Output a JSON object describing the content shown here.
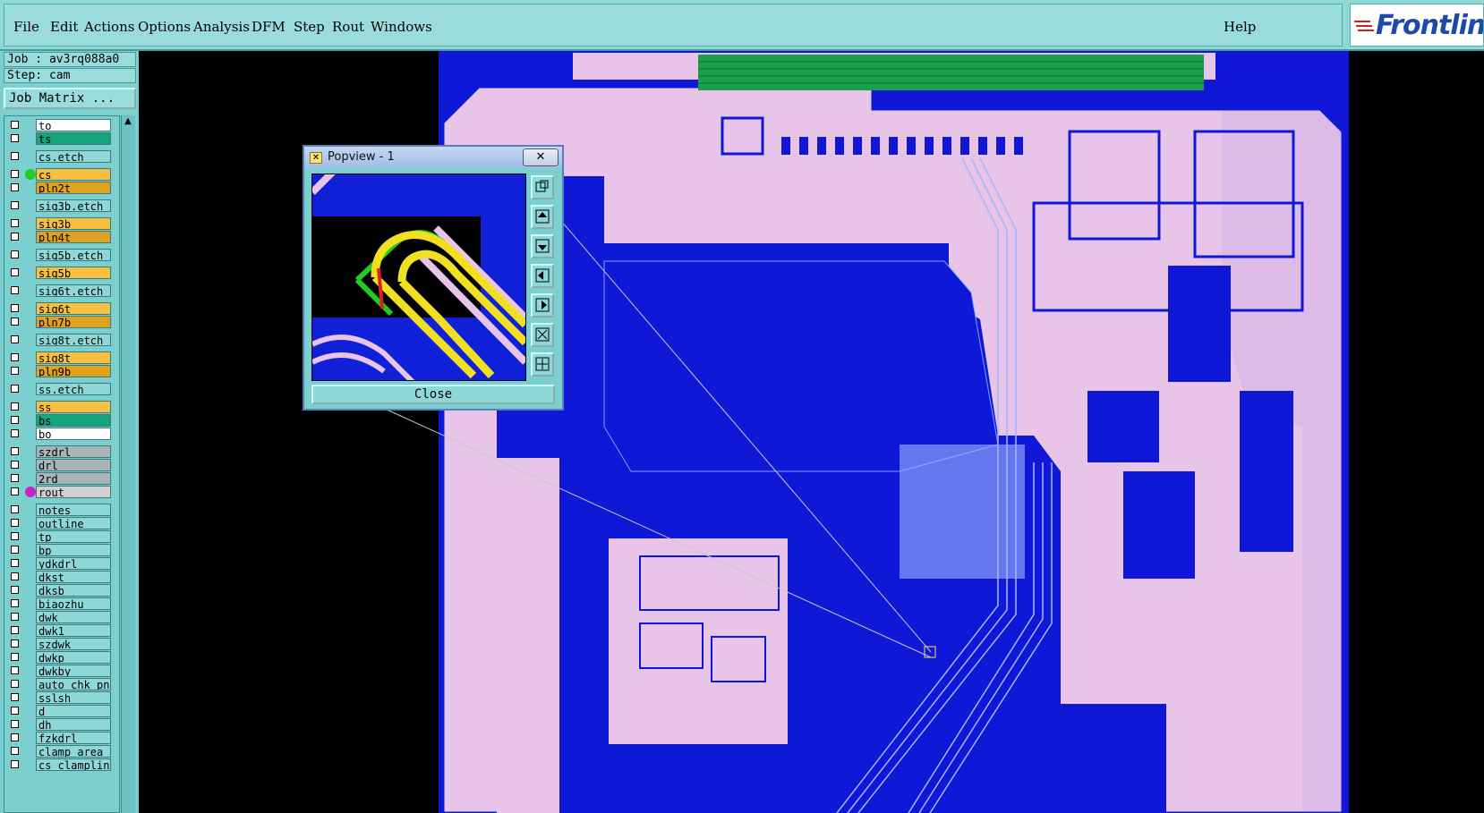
{
  "menu": {
    "items": [
      {
        "label": "File",
        "key": "file"
      },
      {
        "label": "Edit",
        "key": "edit"
      },
      {
        "label": "Actions",
        "key": "actions"
      },
      {
        "label": "Options",
        "key": "options"
      },
      {
        "label": "Analysis",
        "key": "analysis"
      },
      {
        "label": "DFM",
        "key": "dfm"
      },
      {
        "label": "Step",
        "key": "step"
      },
      {
        "label": "Rout",
        "key": "rout"
      },
      {
        "label": "Windows",
        "key": "windows"
      }
    ],
    "help": "Help"
  },
  "logo": {
    "text": "Frontline",
    "brand_color": "#1c4aa8"
  },
  "job": {
    "job_line": "Job : av3rq088a0",
    "step_line": "Step: cam",
    "matrix_button": "Job Matrix ..."
  },
  "layers": [
    {
      "name": "to",
      "color": "#ffffff",
      "dot": ""
    },
    {
      "name": "ts",
      "color": "#14a67a",
      "dot": ""
    },
    {
      "name": "cs.etch",
      "color": "#8fd8d8",
      "dot": ""
    },
    {
      "name": "cs",
      "color": "#f8c040",
      "dot": "#22cc22"
    },
    {
      "name": "pln2t",
      "color": "#e0a020",
      "dot": ""
    },
    {
      "name": "sig3b.etch",
      "color": "#8fd8d8",
      "dot": ""
    },
    {
      "name": "sig3b",
      "color": "#f8c040",
      "dot": ""
    },
    {
      "name": "pln4t",
      "color": "#e0a020",
      "dot": ""
    },
    {
      "name": "sig5b.etch",
      "color": "#8fd8d8",
      "dot": ""
    },
    {
      "name": "sig5b",
      "color": "#f8c040",
      "dot": ""
    },
    {
      "name": "sig6t.etch",
      "color": "#8fd8d8",
      "dot": ""
    },
    {
      "name": "sig6t",
      "color": "#f8c040",
      "dot": ""
    },
    {
      "name": "pln7b",
      "color": "#e0a020",
      "dot": ""
    },
    {
      "name": "sig8t.etch",
      "color": "#8fd8d8",
      "dot": ""
    },
    {
      "name": "sig8t",
      "color": "#f8c040",
      "dot": ""
    },
    {
      "name": "pln9b",
      "color": "#e0a020",
      "dot": ""
    },
    {
      "name": "ss.etch",
      "color": "#8fd8d8",
      "dot": ""
    },
    {
      "name": "ss",
      "color": "#f8c040",
      "dot": ""
    },
    {
      "name": "bs",
      "color": "#14a67a",
      "dot": ""
    },
    {
      "name": "bo",
      "color": "#ffffff",
      "dot": ""
    },
    {
      "name": "szdrl",
      "color": "#a8b4b8",
      "dot": ""
    },
    {
      "name": "drl",
      "color": "#a8b4b8",
      "dot": ""
    },
    {
      "name": "2rd",
      "color": "#a8b4b8",
      "dot": ""
    },
    {
      "name": "rout",
      "color": "#d0d0d0",
      "dot": "#cc22cc"
    },
    {
      "name": "notes",
      "color": "#8fd8d8",
      "dot": ""
    },
    {
      "name": "outline",
      "color": "#8fd8d8",
      "dot": ""
    },
    {
      "name": "tp",
      "color": "#8fd8d8",
      "dot": ""
    },
    {
      "name": "bp",
      "color": "#8fd8d8",
      "dot": ""
    },
    {
      "name": "ydkdrl",
      "color": "#8fd8d8",
      "dot": ""
    },
    {
      "name": "dkst",
      "color": "#8fd8d8",
      "dot": ""
    },
    {
      "name": "dksb",
      "color": "#8fd8d8",
      "dot": ""
    },
    {
      "name": "biaozhu",
      "color": "#8fd8d8",
      "dot": ""
    },
    {
      "name": "dwk",
      "color": "#8fd8d8",
      "dot": ""
    },
    {
      "name": "dwk1",
      "color": "#8fd8d8",
      "dot": ""
    },
    {
      "name": "szdwk",
      "color": "#8fd8d8",
      "dot": ""
    },
    {
      "name": "dwkp",
      "color": "#8fd8d8",
      "dot": ""
    },
    {
      "name": "dwkby",
      "color": "#8fd8d8",
      "dot": ""
    },
    {
      "name": "auto_chk_pnl",
      "color": "#8fd8d8",
      "dot": ""
    },
    {
      "name": "sslsh",
      "color": "#8fd8d8",
      "dot": ""
    },
    {
      "name": "d",
      "color": "#8fd8d8",
      "dot": ""
    },
    {
      "name": "dh",
      "color": "#8fd8d8",
      "dot": ""
    },
    {
      "name": "fzkdrl",
      "color": "#8fd8d8",
      "dot": ""
    },
    {
      "name": "clamp_area",
      "color": "#8fd8d8",
      "dot": ""
    },
    {
      "name": "cs_clampline",
      "color": "#8fd8d8",
      "dot": ""
    }
  ],
  "popup": {
    "title": "Popview - 1",
    "close_x": "✕",
    "close_button": "Close",
    "tools": [
      "zoom-home-icon",
      "pan-up-icon",
      "pan-down-icon",
      "pan-left-icon",
      "pan-right-icon",
      "zoom-fit-icon",
      "zoom-stretch-icon"
    ]
  },
  "colors": {
    "board_fill": "#e8c4e8",
    "copper": "#1018d8",
    "background": "#000000",
    "ui_panel": "#8fd8d8"
  }
}
